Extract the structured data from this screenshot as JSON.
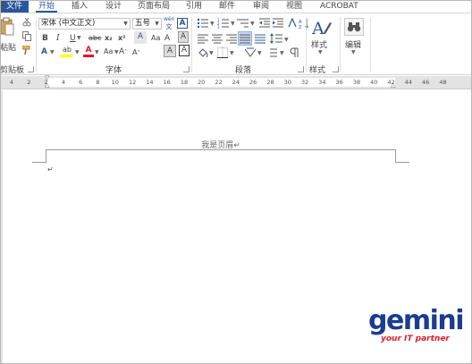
{
  "tabs": [
    {
      "id": "file",
      "label": "文件"
    },
    {
      "id": "home",
      "label": "开始"
    },
    {
      "id": "insert",
      "label": "插入"
    },
    {
      "id": "design",
      "label": "设计"
    },
    {
      "id": "layout",
      "label": "页面布局"
    },
    {
      "id": "references",
      "label": "引用"
    },
    {
      "id": "mailings",
      "label": "邮件"
    },
    {
      "id": "review",
      "label": "审阅"
    },
    {
      "id": "view",
      "label": "视图"
    },
    {
      "id": "acrobat",
      "label": "ACROBAT"
    }
  ],
  "clipboard": {
    "paste_label": "粘贴",
    "group_label": "剪贴板"
  },
  "font": {
    "font_name": "宋体 (中文正文)",
    "font_size": "五号",
    "wen_label": "文",
    "group_label": "字体",
    "bold": "B",
    "italic": "I",
    "underline": "U",
    "strike": "abc",
    "subscript": "x₂",
    "superscript": "x²",
    "grow": "A",
    "shrink": "A",
    "aa": "Aa",
    "clear_a": "A",
    "border_a": "A",
    "wen_a": "A",
    "highlight_ab": "ab",
    "font_color": "A",
    "font_a": "A"
  },
  "paragraph": {
    "group_label": "段落"
  },
  "styles": {
    "label": "样式",
    "group_label": "样式"
  },
  "editing": {
    "label": "编辑"
  },
  "ruler": {
    "numbers": [
      "4",
      "2",
      "2",
      "4",
      "6",
      "8",
      "10",
      "12",
      "14",
      "16",
      "18",
      "20",
      "22",
      "24",
      "26",
      "28",
      "30",
      "32",
      "34",
      "36",
      "38",
      "40",
      "42",
      "44",
      "46",
      "48"
    ]
  },
  "document": {
    "header_text": "我是页眉↵",
    "para_mark": "↵"
  },
  "logo": {
    "word": "gemini",
    "tagline": "your IT partner"
  },
  "colors": {
    "file_tab": "#2b579a",
    "accent": "#2b579a",
    "font_color_bar": "#e81123",
    "logo_blue": "#1c3d8f",
    "logo_red": "#e01e2e"
  }
}
